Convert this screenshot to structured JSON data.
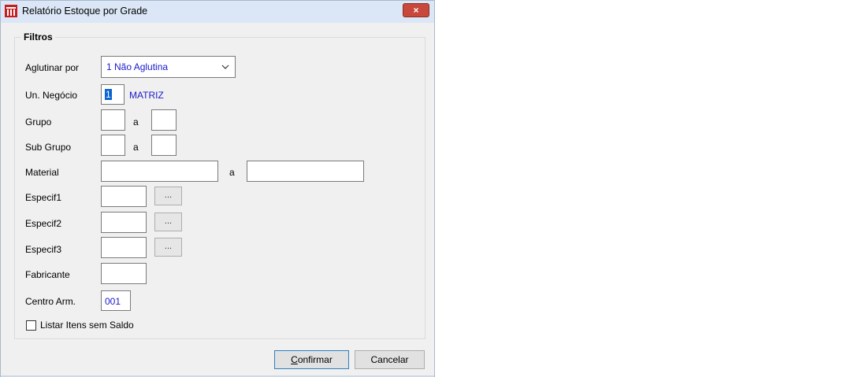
{
  "window": {
    "title": "Relatório Estoque por Grade",
    "close_label": "×"
  },
  "filters": {
    "title": "Filtros",
    "aglutinar_label": "Aglutinar por",
    "aglutinar_value": "1 Não Aglutina",
    "un_negocio_label": "Un. Negócio",
    "un_negocio_value": "1",
    "un_negocio_name": "MATRIZ",
    "grupo_label": "Grupo",
    "subgrupo_label": "Sub Grupo",
    "material_label": "Material",
    "a_label": "a",
    "especif1_label": "Especif1",
    "especif2_label": "Especif2",
    "especif3_label": "Especif3",
    "dots_label": "...",
    "fabricante_label": "Fabricante",
    "centro_label": "Centro Arm.",
    "centro_value": "001",
    "listar_label": "Listar Itens sem Saldo",
    "listar_checked": false
  },
  "buttons": {
    "confirm": "Confirmar",
    "cancel": "Cancelar"
  }
}
